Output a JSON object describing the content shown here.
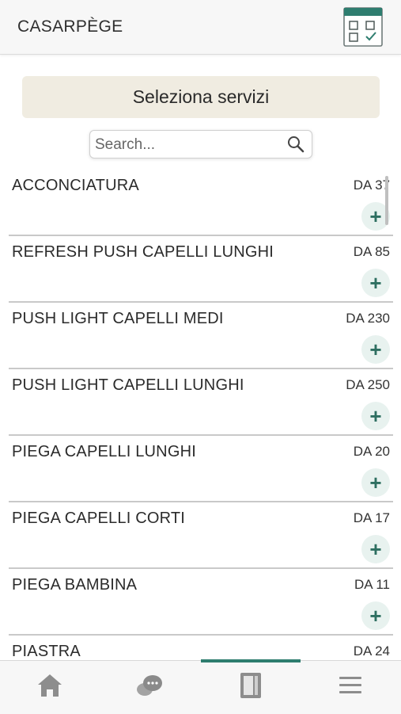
{
  "header": {
    "title": "CASARPÈGE",
    "calendar_icon": "calendar-check-icon"
  },
  "banner": {
    "label": "Seleziona servizi"
  },
  "search": {
    "placeholder": "Search..."
  },
  "services": [
    {
      "name": "ACCONCIATURA",
      "price": "DA 37",
      "add": "+"
    },
    {
      "name": "REFRESH PUSH CAPELLI LUNGHI",
      "price": "DA 85",
      "add": "+"
    },
    {
      "name": "PUSH LIGHT CAPELLI MEDI",
      "price": "DA 230",
      "add": "+"
    },
    {
      "name": "PUSH LIGHT CAPELLI LUNGHI",
      "price": "DA 250",
      "add": "+"
    },
    {
      "name": "PIEGA CAPELLI LUNGHI",
      "price": "DA 20",
      "add": "+"
    },
    {
      "name": "PIEGA CAPELLI CORTI",
      "price": "DA 17",
      "add": "+"
    },
    {
      "name": "PIEGA BAMBINA",
      "price": "DA 11",
      "add": "+"
    },
    {
      "name": "PIASTRA",
      "price": "DA 24",
      "add": "+"
    }
  ],
  "tabbar": {
    "tabs": [
      "home-icon",
      "chat-icon",
      "booklet-icon",
      "menu-icon"
    ],
    "active_tab": 2
  },
  "colors": {
    "accent": "#2e7d6f",
    "banner_bg": "#f0ece1",
    "add_bg": "#e8f2ef"
  }
}
